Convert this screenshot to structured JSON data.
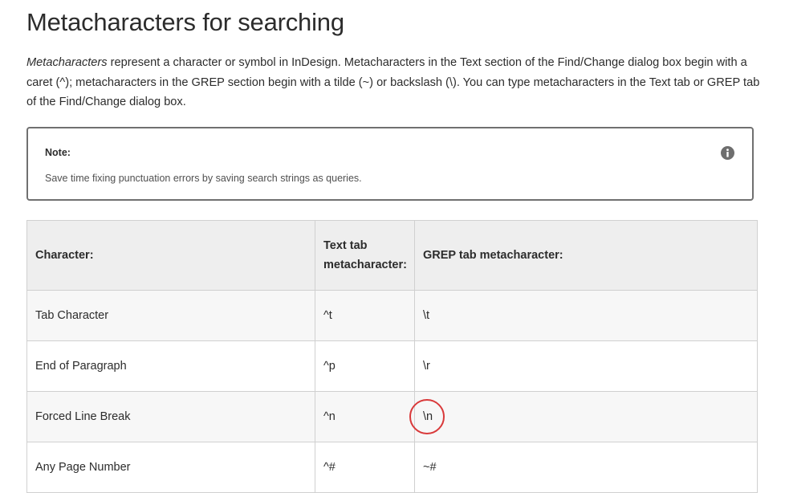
{
  "page_title": "Metacharacters for searching",
  "intro": {
    "lead_italic": "Metacharacters",
    "text": " represent a character or symbol in InDesign. Metacharacters in the Text section of the Find/Change dialog box begin with a caret (^); metacharacters in the GREP section begin with a tilde (~) or backslash (\\). You can type metacharacters in the Text tab or GREP tab of the Find/Change dialog box."
  },
  "note": {
    "title": "Note:",
    "text": "Save time fixing punctuation errors by saving search strings as queries.",
    "icon": "info-icon"
  },
  "table": {
    "headers": {
      "character": "Character:",
      "text_tab": "Text tab metacharacter:",
      "grep_tab": "GREP tab metacharacter:"
    },
    "rows": [
      {
        "character": "Tab Character",
        "text_tab": "^t",
        "grep_tab": "\\t"
      },
      {
        "character": "End of Paragraph",
        "text_tab": "^p",
        "grep_tab": "\\r"
      },
      {
        "character": "Forced Line Break",
        "text_tab": "^n",
        "grep_tab": "\\n"
      },
      {
        "character": "Any Page Number",
        "text_tab": "^#",
        "grep_tab": "~#"
      }
    ]
  },
  "highlight_color": "#d9393a"
}
